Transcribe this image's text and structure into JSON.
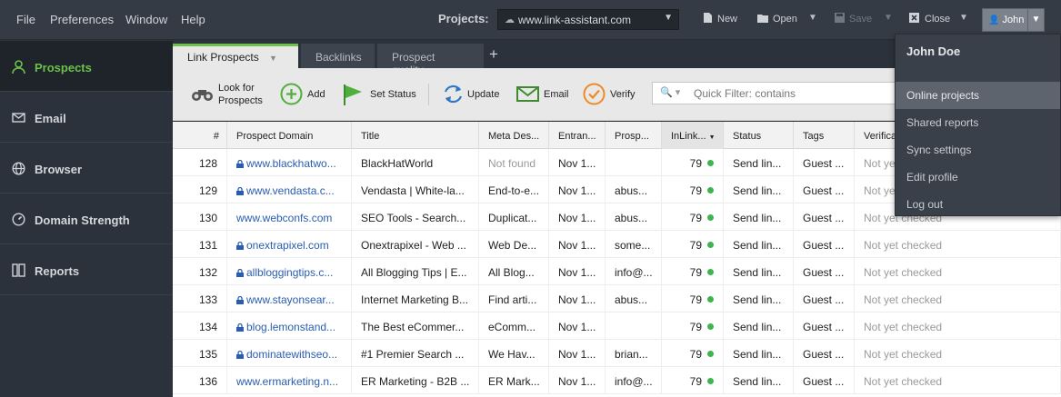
{
  "menubar": {
    "file": "File",
    "preferences": "Preferences",
    "window": "Window",
    "help": "Help"
  },
  "projects": {
    "label": "Projects:",
    "selected": "www.link-assistant.com"
  },
  "toolbar_top": {
    "new": "New",
    "open": "Open",
    "save": "Save",
    "close": "Close",
    "user": "John"
  },
  "sidebar": {
    "items": [
      {
        "label": "Prospects",
        "icon": "prospects-icon"
      },
      {
        "label": "Email",
        "icon": "email-icon"
      },
      {
        "label": "Browser",
        "icon": "globe-icon"
      },
      {
        "label": "Domain Strength",
        "icon": "gauge-icon"
      },
      {
        "label": "Reports",
        "icon": "reports-icon"
      }
    ]
  },
  "tabs": {
    "link_prospects": "Link Prospects",
    "backlinks": "Backlinks",
    "prospect_quality": "Prospect quality",
    "add": "+"
  },
  "tools": {
    "look_for_1": "Look for",
    "look_for_2": "Prospects",
    "add": "Add",
    "set_status": "Set Status",
    "update": "Update",
    "email": "Email",
    "verify": "Verify"
  },
  "quick_filter": {
    "placeholder": "Quick Filter: contains"
  },
  "table": {
    "headers": [
      "#",
      "Prospect Domain",
      "Title",
      "Meta Des...",
      "Entran...",
      "Prosp...",
      "InLink...",
      "Status",
      "Tags",
      "Verificat..."
    ],
    "rows": [
      {
        "n": "128",
        "domain": "www.blackhatwo...",
        "lock": true,
        "title": "BlackHatWorld",
        "meta": "Not found",
        "meta_gray": true,
        "ent": "Nov 1...",
        "prosp": "",
        "inlink": "79",
        "status": "Send lin...",
        "tags": "Guest ...",
        "verif": "Not yet checked"
      },
      {
        "n": "129",
        "domain": "www.vendasta.c...",
        "lock": true,
        "title": "Vendasta | White-la...",
        "meta": "End-to-e...",
        "meta_gray": false,
        "ent": "Nov 1...",
        "prosp": "abus...",
        "inlink": "79",
        "status": "Send lin...",
        "tags": "Guest ...",
        "verif": "Not yet checked"
      },
      {
        "n": "130",
        "domain": "www.webconfs.com",
        "lock": false,
        "title": "SEO Tools - Search...",
        "meta": "Duplicat...",
        "meta_gray": false,
        "ent": "Nov 1...",
        "prosp": "abus...",
        "inlink": "79",
        "status": "Send lin...",
        "tags": "Guest ...",
        "verif": "Not yet checked"
      },
      {
        "n": "131",
        "domain": "onextrapixel.com",
        "lock": true,
        "title": "Onextrapixel - Web ...",
        "meta": "Web De...",
        "meta_gray": false,
        "ent": "Nov 1...",
        "prosp": "some...",
        "inlink": "79",
        "status": "Send lin...",
        "tags": "Guest ...",
        "verif": "Not yet checked"
      },
      {
        "n": "132",
        "domain": "allbloggingtips.c...",
        "lock": true,
        "title": "All Blogging Tips | E...",
        "meta": "All Blog...",
        "meta_gray": false,
        "ent": "Nov 1...",
        "prosp": "info@...",
        "inlink": "79",
        "status": "Send lin...",
        "tags": "Guest ...",
        "verif": "Not yet checked"
      },
      {
        "n": "133",
        "domain": "www.stayonsear...",
        "lock": true,
        "title": "Internet Marketing B...",
        "meta": "Find arti...",
        "meta_gray": false,
        "ent": "Nov 1...",
        "prosp": "abus...",
        "inlink": "79",
        "status": "Send lin...",
        "tags": "Guest ...",
        "verif": "Not yet checked"
      },
      {
        "n": "134",
        "domain": "blog.lemonstand...",
        "lock": true,
        "title": "The Best eCommer...",
        "meta": "eComm...",
        "meta_gray": false,
        "ent": "Nov 1...",
        "prosp": "",
        "inlink": "79",
        "status": "Send lin...",
        "tags": "Guest ...",
        "verif": "Not yet checked"
      },
      {
        "n": "135",
        "domain": "dominatewithseo...",
        "lock": true,
        "title": "#1 Premier Search ...",
        "meta": "We Hav...",
        "meta_gray": false,
        "ent": "Nov 1...",
        "prosp": "brian...",
        "inlink": "79",
        "status": "Send lin...",
        "tags": "Guest ...",
        "verif": "Not yet checked"
      },
      {
        "n": "136",
        "domain": "www.ermarketing.n...",
        "lock": false,
        "title": "ER Marketing - B2B ...",
        "meta": "ER Mark...",
        "meta_gray": false,
        "ent": "Nov 1...",
        "prosp": "info@...",
        "inlink": "79",
        "status": "Send lin...",
        "tags": "Guest ...",
        "verif": "Not yet checked"
      }
    ]
  },
  "user_menu": {
    "name": "John Doe",
    "items": [
      "Online projects",
      "Shared reports",
      "Sync settings",
      "Edit profile",
      "Log out"
    ]
  },
  "colors": {
    "accent": "#6ac24a",
    "link": "#2a5db0",
    "dot": "#3fb34f"
  }
}
